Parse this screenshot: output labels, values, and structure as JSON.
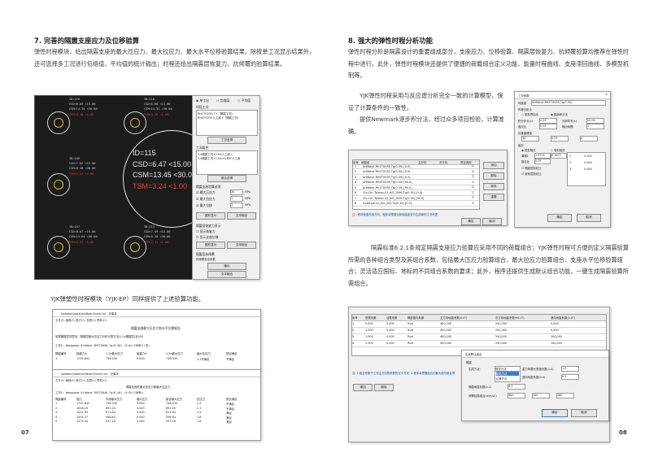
{
  "left": {
    "section7_title": "7. 完善的隔震支座应力及位移验算",
    "section7_body": "弹性时程模块，给出隔震支座的最大压应力、最大拉应力、最大水平位移验算结果，除按单工况显示结果外，还可选择多工况进行包络值、平均值的统计输出；时程还给出隔震层恢复力、抗倾覆的验算结果。",
    "caption": "YJK弹塑性时程模块（YJK-EP）同样提供了上述验算功能。",
    "page_number": "07",
    "cad_labels": [
      {
        "id": "ID=116",
        "cs": "CSD=6.03 <15.00",
        "csm": "CSM=14.35 <30.00",
        "tsm": "TSM=3.10 <1.00"
      },
      {
        "id": "ID=116",
        "cs": "CSD=6.08 <15.00",
        "csm": "CSM=14.32 <30.00",
        "tsm": "TSM=3.28 <1.00"
      },
      {
        "id": "ID=109",
        "cs": "CSD=7.02 <15.00",
        "csm": "CSM=9.58 <30.00",
        "tsm": "TSM=2.89 <1.00"
      },
      {
        "id": "ID=107",
        "cs": "CSD=8.07 <15.00",
        "csm": "CSM=13.64 <30.00",
        "tsm": "TSM=2.37 <1.00"
      },
      {
        "id": "ID=114",
        "cs": "CSD=7.49 <15.00",
        "csm": "CSM=5.28 <30.00",
        "tsm": "TSM=2.11 <1.00"
      }
    ],
    "zoom": {
      "id": "ID=115",
      "cs": "CSD=6.47 <15.00",
      "csm": "CSM=13.45 <30.00",
      "tsm": "TSM=3.24 <1.00"
    },
    "side_panel": {
      "radio1": "单工况",
      "radio2": "包络值",
      "radio3": "平均值",
      "group1": "时程工况",
      "list1_a": "RH1TG035-7-Y（隔震工况)",
      "list1_b": "RH4TG035人工波-Y（隔震工况)",
      "btn_cases": "工况选择",
      "group2": "工况组合",
      "list2_a": "1.0隔震工况+1.0X人工波-1",
      "list2_b": "1.0隔震工况+1.0X+0.85Y人工波",
      "btn_combo": "组合选择",
      "group3": "隔震支座验算选项",
      "chk1": "最大压应力",
      "chk2": "最大拉应力",
      "chk3": "最大位移",
      "val1": "30",
      "val2": "1",
      "val3": "1",
      "unit": "MPa",
      "btn_draw": "图形显示",
      "btn_text": "文本输出",
      "group4": "隔震层恢复力显示",
      "chk4": "显示恢复力",
      "chk5": "显示支座位移",
      "btn_draw2": "图形显示",
      "btn_text2": "文本输出",
      "group5": "隔震层抗倾覆",
      "label5": "抗倾覆安全系数",
      "btn_ok": "输出",
      "btn_text3": "文本输出"
    },
    "report": {
      "title": "Isolation\\Isolation\\BearCheck.txt - 记事本",
      "menu": "文件(F)  编辑(E)  格式(O)  查看(V)  帮助(H)",
      "heading": "隔震支座最大压应力和水平位移报告",
      "line1": "验算隔震层的层号、隔震层最大压应力分布计算方法(1.0x隔震层)及200",
      "line2": "工况1: Wangweam  ArtWave RH1TG040,Tg(0.40) (X:0)(COMB1)(压)",
      "cols": [
        "隔震编号",
        "轴重力/t",
        "1.2x最大压力",
        "轴重力/t",
        "1.2x最大压力",
        "最大压应力",
        "是否满足"
      ],
      "row": [
        "1",
        "1735.842",
        "736.335",
        "0.000",
        "736.335",
        "2.2不满足",
        "不满足"
      ],
      "title2": "Isolation\\Isolation\\BearCheck2.txt - 记事本",
      "heading2": "隔震支座的最大压应力和最大拉应力",
      "line3": "工况1: Wangwuam  ArtWave RH1TG040,Tg(0.40) (X:0)(COMB1)",
      "cols2": [
        "隔震编号",
        "轴力",
        "作用最大压力",
        "最大拉力",
        "组合最大拉力",
        "拉应力",
        "是否满足"
      ],
      "rows2": [
        [
          "1",
          "1735.842",
          "736.335",
          "0.000",
          "736.335",
          "2.2",
          "不满足"
        ],
        [
          "2",
          "1628.10",
          "692.25",
          "0.000",
          "692.25",
          "2.1",
          "不满足"
        ],
        [
          "3",
          "1522.53",
          "611.84",
          "0.000",
          "611.84",
          "1.9",
          "满足"
        ],
        [
          "4",
          "1491.27",
          "598.63",
          "0.000",
          "598.63",
          "1.8",
          "满足"
        ],
        [
          "5",
          "1375.94",
          "537.16",
          "0.000",
          "537.16",
          "1.6",
          "满足"
        ]
      ]
    }
  },
  "right": {
    "section8_title": "8. 强大的弹性时程分析功能",
    "section8_body": "弹性时程分析是隔震设计的重要组成部分，支座应力、位移验算、隔震层恢复力、抗倾覆验算均推荐在弹性时程中进行，此外，弹性时程模块还提供了便捷的荷载组合定义功能、能量时程曲线、支座滞回曲线、多模型机制等。",
    "body2_a": "YJK弹性时程采用与反应谱分析完全一致的计算模型，保证了计算条件的一致性。",
    "body2_b": "提供Newmark逐步积分法，经过众多项目检验，计算准确。",
    "body3": "隔震标准6.2.1条规定隔震支座应力验算应采用不同的荷载组合；YJK弹性时程可方便的定义隔震验算所需的各种组合类型及其组合系数，包括最大压应力验算组合、最大拉应力验算组合、支座水平位移验算组合；灵活适应国标、地标的不同组合系数的要求；此外，程序还提供生成默认组合功能，一键生成隔震验算所需组合。",
    "page_number": "08",
    "dlg_wave": {
      "cols": [
        "序号",
        "地震波",
        "主方向",
        "次方向",
        "是否选用"
      ],
      "rows": [
        "ArtWave-RH1TG035,Tg(0.35) [0.0]",
        "ArtWave-RH1TG035,Tg(0.35) [0.0]",
        "ArtWave-RH4TG035,Tg(0.35) [0.0]",
        "ArtWave-RH4TG035,Tg(0.35) [90.0]",
        "ArtWave-RH1TG035,Tg(0.35) [90.0]",
        "Chi-Chi, Taiwan-01_NO_2596,Tg(0.35) [0.0]",
        "Chi-Chi, Taiwan-02_NO_2006,Tg(0.35) [90.0]",
        "Coalinga-01_NO_342,Tg(0.35) [0.0]"
      ],
      "btns": [
        "添加",
        "删除",
        "修改",
        "重置"
      ],
      "note": "注：修改地震作用方向、程序将根据当前地震波进行生成新的工况列表",
      "ok": "确定",
      "cancel": "取消"
    },
    "dlg_param": {
      "title": "工况参数",
      "label1": "地震波",
      "wave": "ArtWave-RH1TG035,Tg(0.35)",
      "sec1": "时程分析法",
      "r1": "振型叠加法",
      "r2": "直接积分法",
      "f1": "积分步长(s)",
      "v1": "0.02",
      "f2": "分析时长(s)",
      "v2": "20.00",
      "f3": "阻尼比",
      "v3": "0.05",
      "f4": "输出间隔",
      "v4": "1",
      "sec2": "加速度峰值",
      "v5": "35",
      "v6": "0.25",
      "v7": "0",
      "sec3": "阻尼",
      "r3": "振型阻尼",
      "r4": "瑞利阻尼",
      "f5": "周期1",
      "v8": "1.9721",
      "v9": "0.1871",
      "f6": "阻尼比",
      "v10": "0.05",
      "chk1": "隔震层阻尼比",
      "chk2": "其他层阻尼比",
      "tbl": [
        "1",
        "2",
        "3"
      ],
      "tbl_v": [
        "0.000",
        "0.000",
        "0.000"
      ],
      "ok": "确定",
      "cancel": "取消"
    },
    "dlg_combo": {
      "cols": [
        "序号",
        "恒载系数",
        "活载系数",
        "隔震竖向系数",
        "主方向地震系数(0.0°)",
        "次方向地震系数(90.0°)",
        "竖向地震系数(0.0°)"
      ],
      "rows": [
        [
          "1",
          "0.000",
          "0.000",
          "Rcal",
          "400,000",
          "240,000",
          "0,000"
        ],
        [
          "2",
          "1.000",
          "0.500",
          "Rcal",
          "400,000",
          "240,000",
          "0,000"
        ],
        [
          "3",
          "1.000",
          "0.500",
          "Rcal",
          "400,000",
          "240,000",
          "100,000"
        ],
        [
          "4",
          "1.000",
          "0.000",
          "Rcal",
          "400,000",
          "240,000",
          "100,000"
        ]
      ],
      "note": "注: 1.组合系数于工况主方向的系数的定义方式: 2.程序将根据组合的最大值与组合项",
      "btns": [
        "增加",
        "删除",
        "确定",
        "取消"
      ]
    },
    "dlg_gen": {
      "title": "生成默认组合",
      "label1": "隔震",
      "f1": "生成方法:",
      "v1": "规范方法",
      "opt1": "规范方法",
      "opt2": "位移方法",
      "f2": "重力荷载代表值系数(1.0)",
      "v2": "1.0",
      "f3": "竖向地震系数(0.5)",
      "v3": "0.2",
      "f4": "隔震地震系数(0.1)",
      "v4": "0.2",
      "f5": "倾覆验算组合(mm/s2)",
      "v5": "400",
      "v6": "340",
      "v7": "260",
      "ok": "确定",
      "cancel": "取消"
    }
  }
}
